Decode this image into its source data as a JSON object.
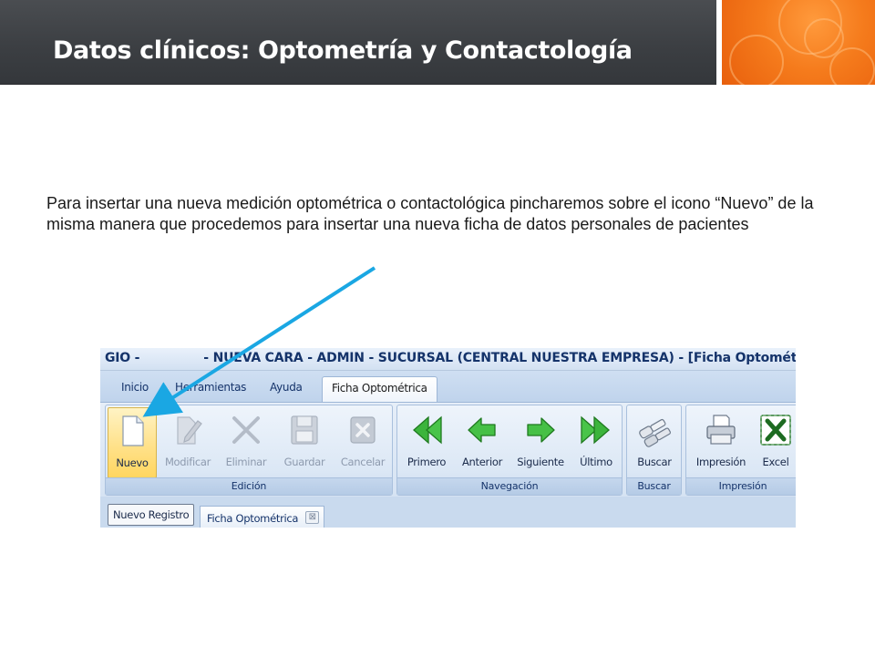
{
  "slide": {
    "title": "Datos clínicos: Optometría y Contactología",
    "body": "Para insertar una nueva medición optométrica o contactológica pincharemos sobre el icono “Nuevo” de la misma manera que procedemos para insertar una nueva ficha de datos personales de pacientes"
  },
  "app": {
    "title_prefix": "GIO -",
    "title_rest": "- NUEVA CARA - ADMIN - SUCURSAL (CENTRAL NUESTRA EMPRESA) - [Ficha Optométrica]",
    "menu_tabs": [
      "Inicio",
      "Herramientas",
      "Ayuda",
      "Ficha Optométrica"
    ],
    "groups": {
      "edicion": {
        "label": "Edición",
        "buttons": [
          "Nuevo",
          "Modificar",
          "Eliminar",
          "Guardar",
          "Cancelar"
        ]
      },
      "navegacion": {
        "label": "Navegación",
        "buttons": [
          "Primero",
          "Anterior",
          "Siguiente",
          "Último"
        ]
      },
      "buscar": {
        "label": "Buscar",
        "buttons": [
          "Buscar"
        ]
      },
      "impresion": {
        "label": "Impresión",
        "buttons": [
          "Impresión",
          "Excel"
        ]
      }
    },
    "doc_tabs": [
      "Nuevo Registro",
      "Ficha Optométrica"
    ],
    "close_glyph": "⊠"
  },
  "icons": {
    "nuevo": "new-document-icon",
    "modificar": "edit-document-icon",
    "eliminar": "delete-x-icon",
    "guardar": "floppy-disk-icon",
    "cancelar": "cancel-box-icon",
    "primero": "double-arrow-left-icon",
    "anterior": "arrow-left-icon",
    "siguiente": "arrow-right-icon",
    "ultimo": "double-arrow-right-icon",
    "buscar": "binoculars-icon",
    "impresion": "printer-icon",
    "excel": "excel-icon"
  },
  "colors": {
    "header_bg": "#3c3f43",
    "accent_orange": "#f57b1c",
    "arrow": "#1aa7e3",
    "ribbon_blue": "#d6e3f3",
    "highlight": "#ffd660"
  }
}
